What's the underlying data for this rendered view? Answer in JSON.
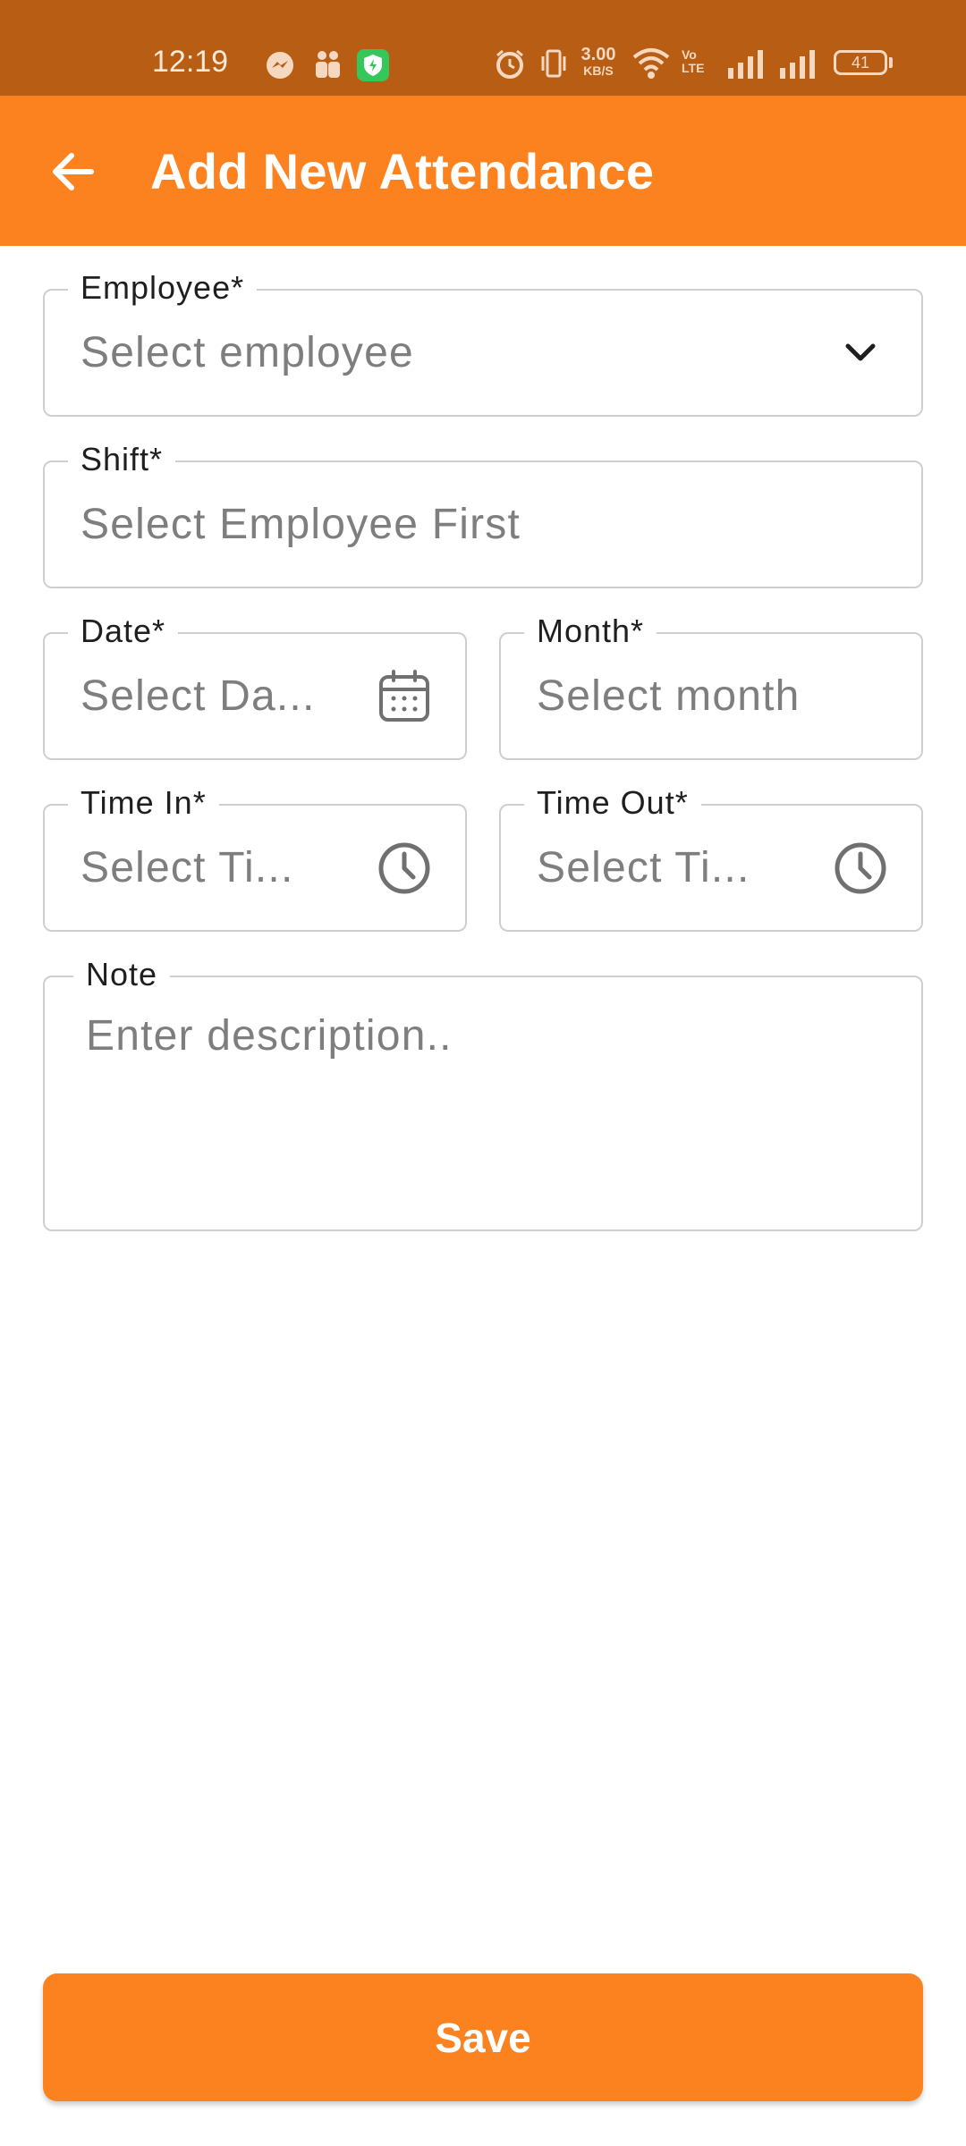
{
  "status_bar": {
    "time": "12:19",
    "net_speed_value": "3.00",
    "net_speed_unit": "KB/S",
    "volte_label": "Vo LTE",
    "battery": "41"
  },
  "appbar": {
    "title": "Add New Attendance",
    "color": "#fc821f"
  },
  "form": {
    "employee": {
      "label": "Employee*",
      "placeholder": "Select employee"
    },
    "shift": {
      "label": "Shift*",
      "placeholder": "Select Employee First"
    },
    "date": {
      "label": "Date*",
      "placeholder": "Select Da..."
    },
    "month": {
      "label": "Month*",
      "placeholder": "Select month"
    },
    "time_in": {
      "label": "Time In*",
      "placeholder": "Select Ti..."
    },
    "time_out": {
      "label": "Time Out*",
      "placeholder": "Select Ti..."
    },
    "note": {
      "label": "Note",
      "placeholder": "Enter description.."
    }
  },
  "save_label": "Save"
}
